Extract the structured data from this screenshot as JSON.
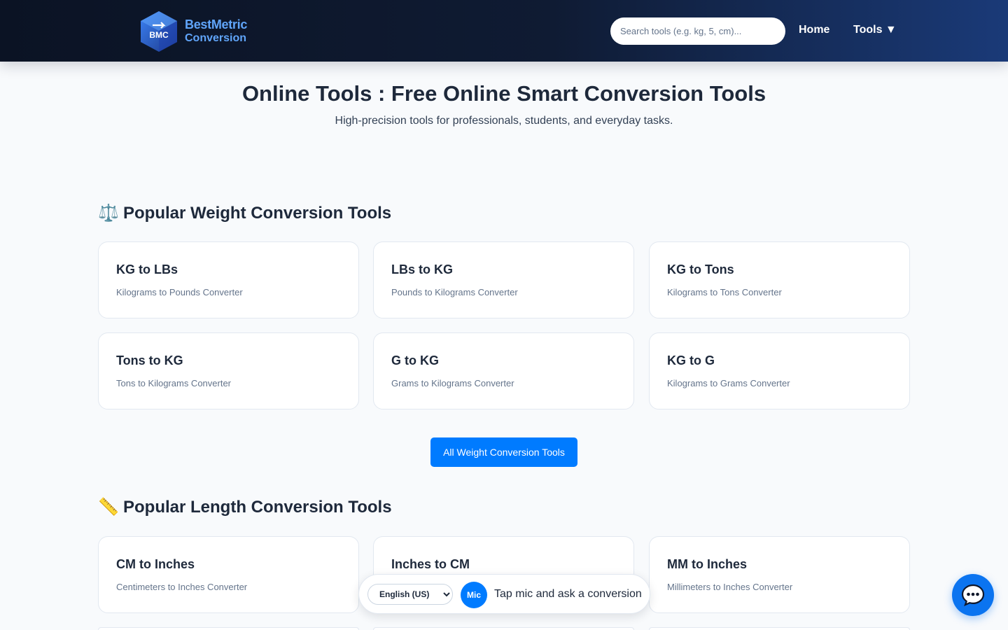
{
  "header": {
    "logo": {
      "badge": "BMC",
      "line1": "BestMetric",
      "line2": "Conversion"
    },
    "search_placeholder": "Search tools (e.g. kg, 5, cm)...",
    "nav": {
      "home": "Home",
      "tools": "Tools ▼"
    }
  },
  "hero": {
    "title": "Online Tools : Free Online Smart Conversion Tools",
    "subtitle": "High-precision tools for professionals, students, and everyday tasks."
  },
  "weight": {
    "emoji": "⚖️",
    "title": "Popular Weight Conversion Tools",
    "cards": [
      {
        "title": "KG to LBs",
        "desc": "Kilograms to Pounds Converter"
      },
      {
        "title": "LBs to KG",
        "desc": "Pounds to Kilograms Converter"
      },
      {
        "title": "KG to Tons",
        "desc": "Kilograms to Tons Converter"
      },
      {
        "title": "Tons to KG",
        "desc": "Tons to Kilograms Converter"
      },
      {
        "title": "G to KG",
        "desc": "Grams to Kilograms Converter"
      },
      {
        "title": "KG to G",
        "desc": "Kilograms to Grams Converter"
      }
    ],
    "all_button": "All Weight Conversion Tools"
  },
  "length": {
    "emoji": "📏",
    "title": "Popular Length Conversion Tools",
    "cards": [
      {
        "title": "CM to Inches",
        "desc": "Centimeters to Inches Converter"
      },
      {
        "title": "Inches to CM",
        "desc": ""
      },
      {
        "title": "MM to Inches",
        "desc": "Millimeters to Inches Converter"
      }
    ]
  },
  "voice": {
    "language": "English (US)",
    "mic_label": "Mic",
    "hint": "Tap mic and ask a conversion"
  },
  "colors": {
    "accent": "#007bff",
    "header_dark": "#0b1324",
    "header_light": "#1a3a78"
  },
  "icons": {
    "chat": "chat-bubble-icon",
    "logo": "cube-logo-icon"
  }
}
